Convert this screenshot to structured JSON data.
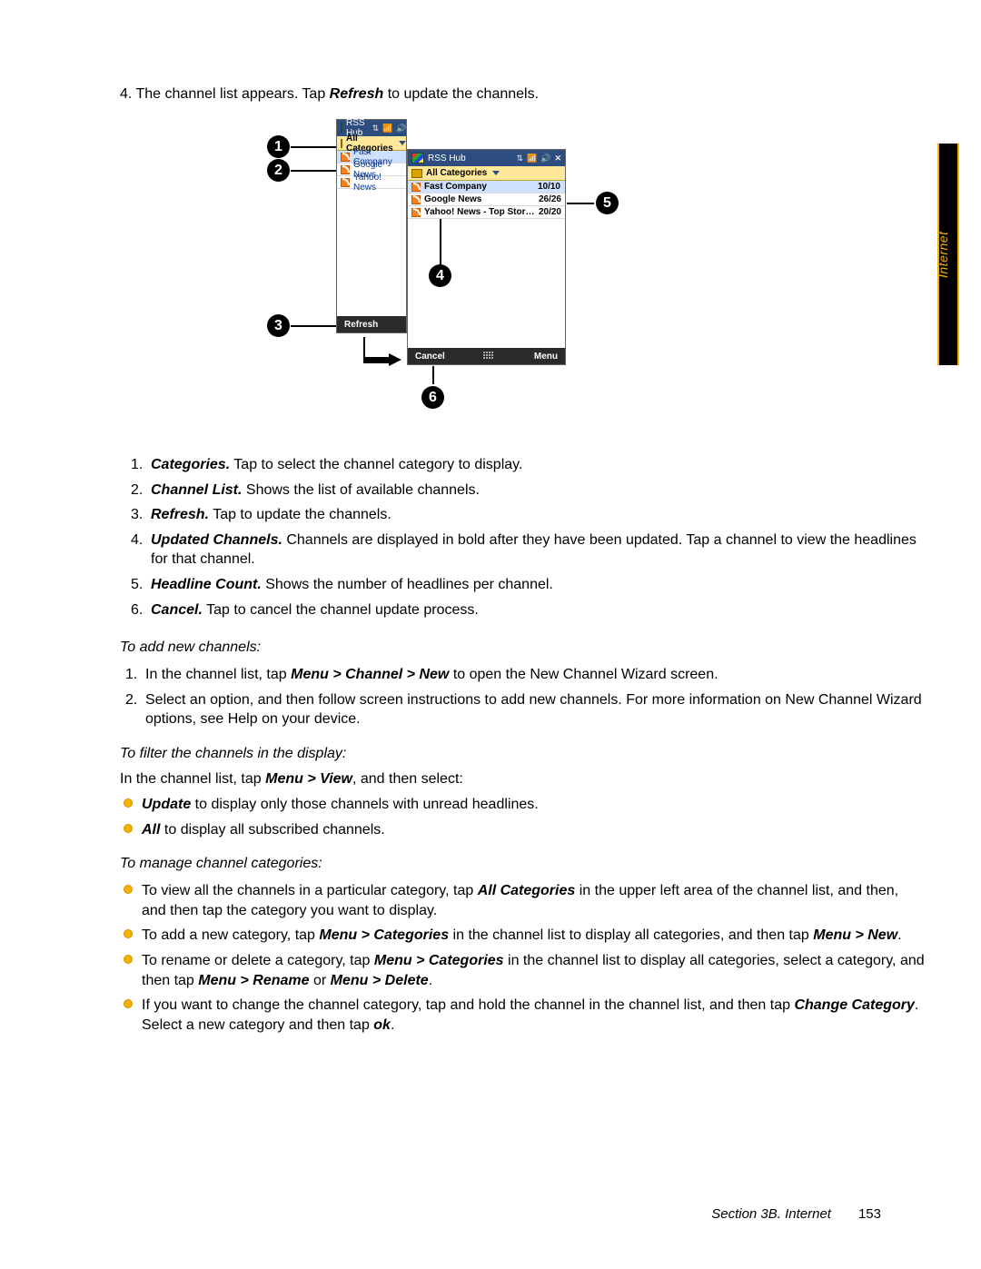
{
  "sidetab": "Internet",
  "intro": {
    "num": "4.",
    "before": "The channel list appears. Tap ",
    "key": "Refresh",
    "after": " to update the channels."
  },
  "fig": {
    "badges": [
      "1",
      "2",
      "3",
      "4",
      "5",
      "6"
    ],
    "deviceA": {
      "title": "RSS Hub",
      "cat": "All Categories",
      "rows": [
        "Fast Company",
        "Google News",
        "Yahoo! News"
      ],
      "soft_left": "Refresh"
    },
    "deviceB": {
      "title": "RSS Hub",
      "cat": "All Categories",
      "rows": [
        {
          "name": "Fast Company",
          "count": "10/10"
        },
        {
          "name": "Google News",
          "count": "26/26"
        },
        {
          "name": "Yahoo! News - Top Stor…",
          "count": "20/20"
        }
      ],
      "soft_left": "Cancel",
      "soft_right": "Menu"
    }
  },
  "legend": [
    {
      "n": "1.",
      "term": "Categories.",
      "text": " Tap to select the channel category to display."
    },
    {
      "n": "2.",
      "term": "Channel List.",
      "text": " Shows the list of available channels."
    },
    {
      "n": "3.",
      "term": "Refresh.",
      "text": " Tap to update the channels."
    },
    {
      "n": "4.",
      "term": "Updated Channels.",
      "text": " Channels are displayed in bold after they have been updated. Tap a channel to view the headlines for that channel."
    },
    {
      "n": "5.",
      "term": "Headline Count.",
      "text": " Shows the number of headlines per channel."
    },
    {
      "n": "6.",
      "term": "Cancel.",
      "text": " Tap to cancel the channel update process."
    }
  ],
  "sec_add": {
    "head": "To add new channels:",
    "items": [
      {
        "n": "1.",
        "before": "In the channel list, tap ",
        "key": "Menu > Channel > New",
        "after": " to open the New Channel Wizard screen."
      },
      {
        "n": "2.",
        "before": "Select an option, and then follow screen instructions to add new channels. For more information on New Channel Wizard options, see Help on your device.",
        "key": "",
        "after": ""
      }
    ]
  },
  "sec_filter": {
    "head": "To filter the channels in the display:",
    "lead_before": "In the channel list, tap ",
    "lead_key": "Menu > View",
    "lead_after": ", and then select:",
    "bullets": [
      {
        "key": "Update",
        "rest": " to display only those channels with unread headlines."
      },
      {
        "key": "All",
        "rest": " to display all subscribed channels."
      }
    ]
  },
  "sec_manage": {
    "head": "To manage channel categories:",
    "bullets": [
      {
        "pre": "To view all the channels in a particular category, tap ",
        "k1": "All Categories",
        "mid": " in the upper left area of the channel list, and then, and then tap the category you want to display.",
        "k2": "",
        "post": ""
      },
      {
        "pre": "To add a new category, tap ",
        "k1": "Menu > Categories",
        "mid": " in the channel list to display all categories, and then tap ",
        "k2": "Menu > New",
        "post": "."
      },
      {
        "pre": "To rename or delete a category, tap ",
        "k1": "Menu > Categories",
        "mid": " in the channel list to display all categories, select a category, and then tap ",
        "k2": "Menu > Rename",
        "post_or": " or ",
        "k3": "Menu > Delete",
        "post": "."
      },
      {
        "pre": "If you want to change the channel category, tap and hold the channel in the channel list, and then tap ",
        "k1": "Change Category",
        "mid": ". Select a new category and then tap ",
        "k2": "ok",
        "post": "."
      }
    ]
  },
  "footer": {
    "section": "Section 3B. Internet",
    "page": "153"
  }
}
